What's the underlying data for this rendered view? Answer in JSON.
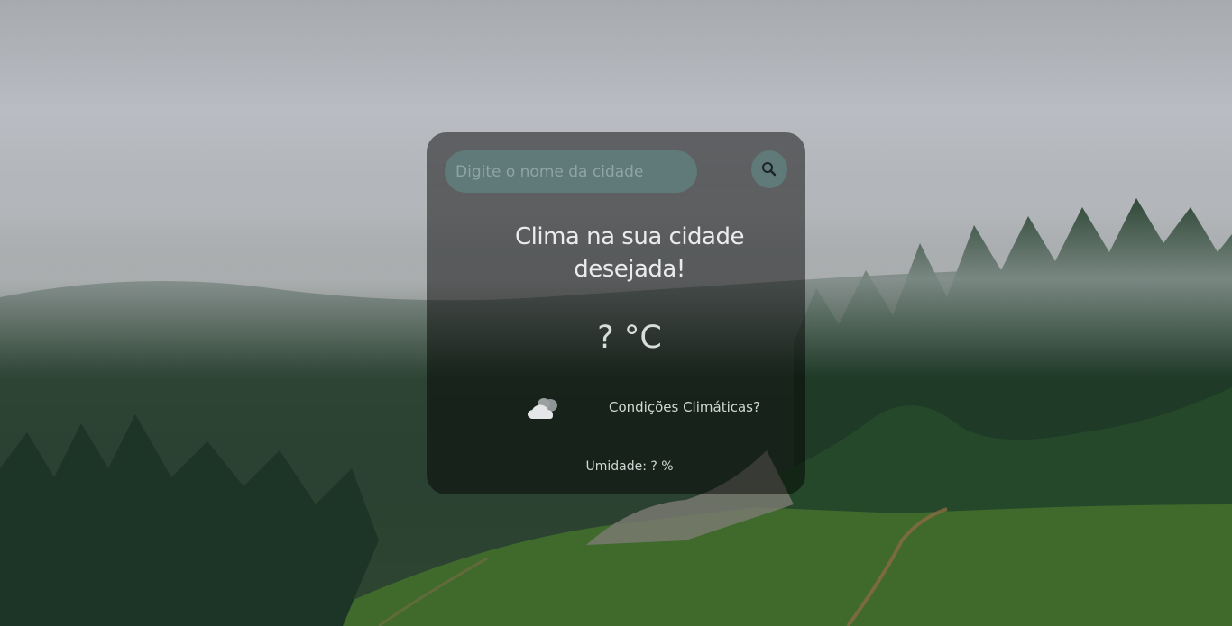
{
  "search": {
    "placeholder": "Digite o nome da cidade",
    "button_icon": "search-icon"
  },
  "main": {
    "title_line1": "Clima na sua cidade",
    "title_line2": "desejada!",
    "temperature": "? °C",
    "weather_icon": "cloud-icon",
    "conditions": "Condições Climáticas?",
    "humidity": "Umidade: ? %"
  },
  "colors": {
    "card_background": "rgba(0,0,0,0.48)",
    "input_background": "#5f7a78",
    "text": "#e9eceb"
  }
}
